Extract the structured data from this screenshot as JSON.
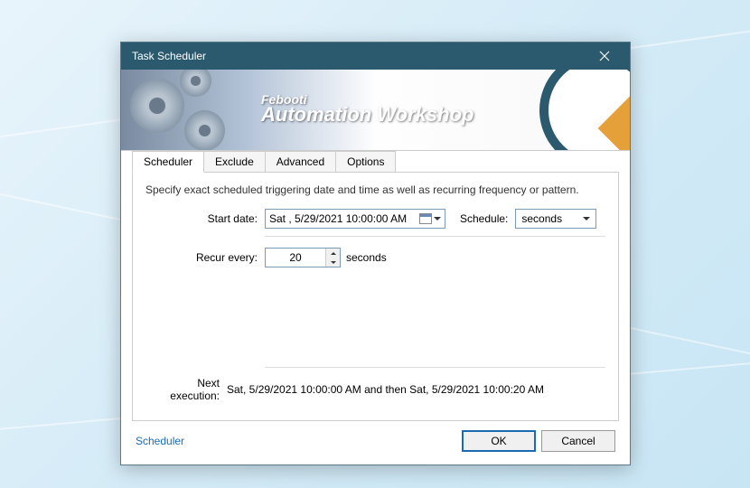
{
  "window": {
    "title": "Task Scheduler"
  },
  "banner": {
    "small": "Febooti",
    "big": "Automation Workshop"
  },
  "tabs": {
    "scheduler": "Scheduler",
    "exclude": "Exclude",
    "advanced": "Advanced",
    "options": "Options"
  },
  "content": {
    "description": "Specify exact scheduled triggering date and time as well as recurring frequency or pattern.",
    "start_date_label": "Start date:",
    "start_date_value": "Sat ,  5/29/2021 10:00:00 AM",
    "schedule_label": "Schedule:",
    "schedule_value": "seconds",
    "recur_label": "Recur every:",
    "recur_value": "20",
    "recur_unit": "seconds",
    "next_exec_label": "Next execution:",
    "next_exec_value": "Sat, 5/29/2021 10:00:00 AM and then Sat, 5/29/2021 10:00:20 AM"
  },
  "footer": {
    "link": "Scheduler",
    "ok": "OK",
    "cancel": "Cancel"
  }
}
